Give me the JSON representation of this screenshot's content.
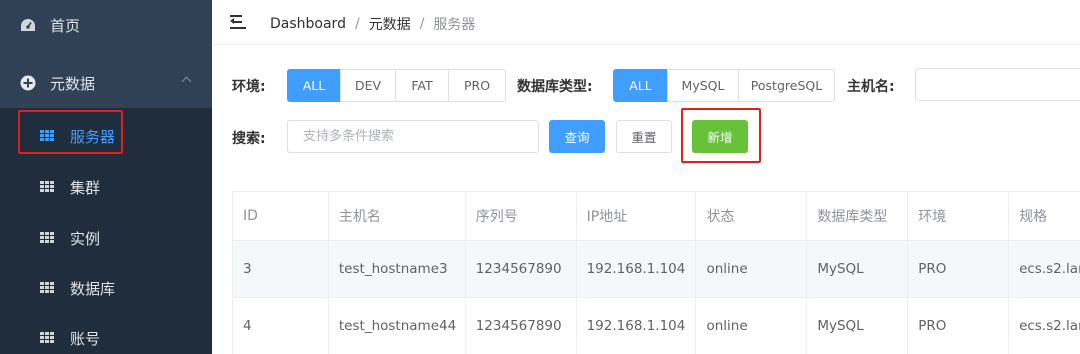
{
  "sidebar": {
    "home_label": "首页",
    "metadata_label": "元数据",
    "sub_items": [
      {
        "label": "服务器"
      },
      {
        "label": "集群"
      },
      {
        "label": "实例"
      },
      {
        "label": "数据库"
      },
      {
        "label": "账号"
      }
    ]
  },
  "breadcrumb": {
    "items": [
      "Dashboard",
      "元数据",
      "服务器"
    ],
    "separator": "/"
  },
  "filters": {
    "env_label": "环境:",
    "env_options": [
      "ALL",
      "DEV",
      "FAT",
      "PRO"
    ],
    "env_selected": "ALL",
    "db_type_label": "数据库类型:",
    "db_type_options": [
      "ALL",
      "MySQL",
      "PostgreSQL"
    ],
    "db_type_selected": "ALL",
    "hostname_label": "主机名:",
    "hostname_value": "",
    "search_label": "搜索:",
    "search_placeholder": "支持多条件搜索",
    "query_button": "查询",
    "reset_button": "重置",
    "add_button": "新增"
  },
  "table": {
    "columns": [
      "ID",
      "主机名",
      "序列号",
      "IP地址",
      "状态",
      "数据库类型",
      "环境",
      "规格"
    ],
    "rows": [
      [
        "3",
        "test_hostname3",
        "1234567890",
        "192.168.1.104",
        "online",
        "MySQL",
        "PRO",
        "ecs.s2.lar"
      ],
      [
        "4",
        "test_hostname44",
        "1234567890",
        "192.168.1.104",
        "online",
        "MySQL",
        "PRO",
        "ecs.s2.lar"
      ]
    ]
  },
  "colors": {
    "sidebar_bg": "#304156",
    "submenu_bg": "#1f2d3d",
    "primary": "#409eff",
    "success": "#67c23a",
    "highlight_box": "#e0201e"
  }
}
